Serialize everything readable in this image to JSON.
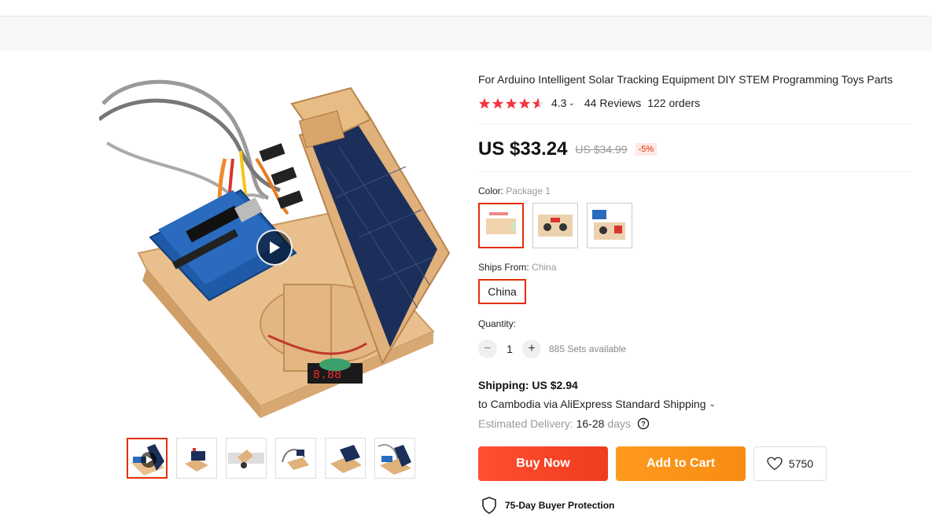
{
  "product": {
    "title": "For Arduino Intelligent Solar Tracking Equipment DIY STEM Programming Toys Parts",
    "rating": "4.3",
    "reviews": "44 Reviews",
    "orders": "122 orders",
    "stars_fraction": 0.86
  },
  "price": {
    "current": "US $33.24",
    "original": "US $34.99",
    "discount": "-5%"
  },
  "color": {
    "label": "Color:",
    "selected": "Package 1"
  },
  "ships_from": {
    "label": "Ships From:",
    "selected": "China",
    "option": "China"
  },
  "quantity": {
    "label": "Quantity:",
    "minus": "−",
    "value": "1",
    "plus": "+",
    "available": "885 Sets available"
  },
  "shipping": {
    "price": "Shipping: US $2.94",
    "to": "to Cambodia via AliExpress Standard Shipping",
    "est_label": "Estimated Delivery:",
    "est_range": "16-28",
    "est_unit": "days"
  },
  "actions": {
    "buy_now": "Buy Now",
    "add_to_cart": "Add to Cart",
    "wishlist_count": "5750"
  },
  "protection": {
    "text": "75-Day Buyer Protection"
  },
  "colors": {
    "accent": "#e62e04",
    "star": "#f5333f",
    "buy": "#f5452a",
    "cart": "#fa931b"
  }
}
